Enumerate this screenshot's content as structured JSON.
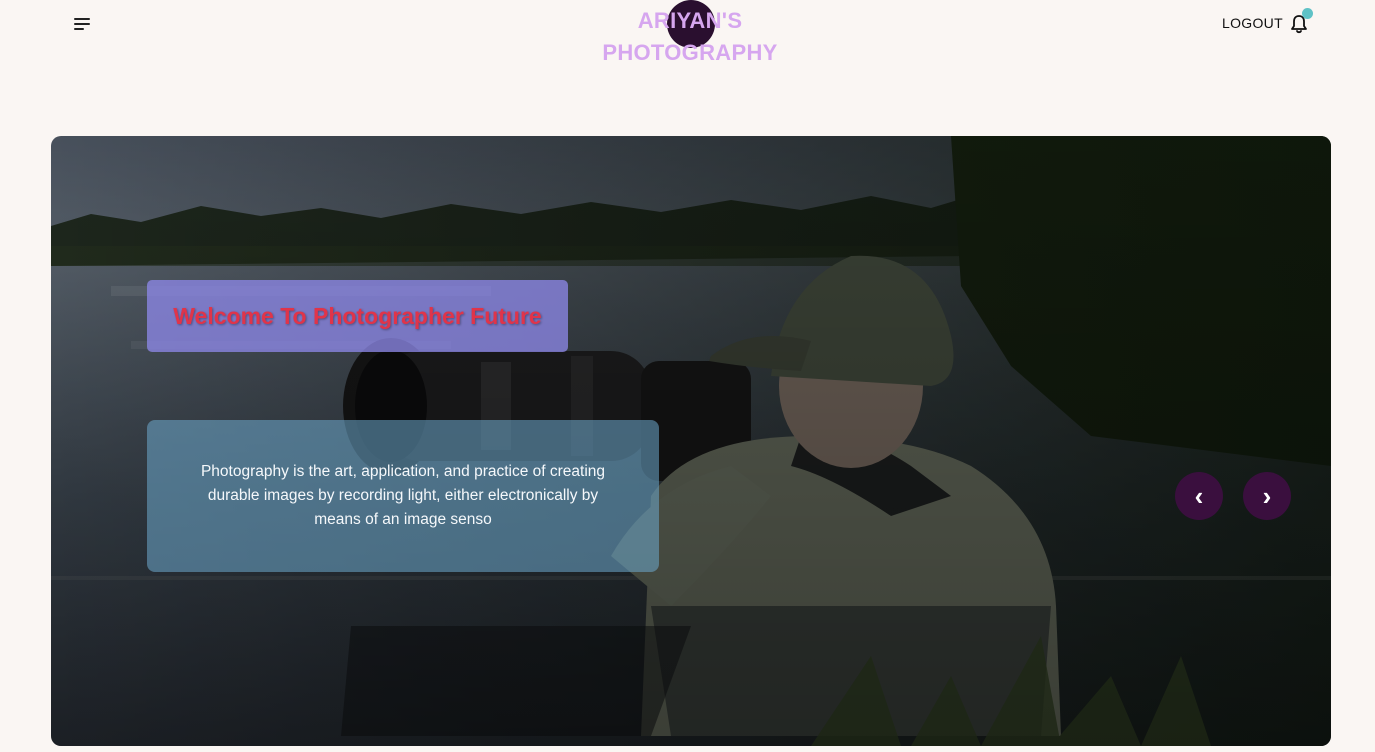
{
  "header": {
    "brand_line1": "ARIYAN'S",
    "brand_line2": "PHOTOGRAPHY",
    "logout_label": "LOGOUT",
    "icons": [
      "menu-icon",
      "bell-icon"
    ]
  },
  "hero": {
    "title": "Welcome To Photographer Future",
    "description": "Photography is the art, application, and practice of creating durable images by recording light, either electronically by means of an image senso",
    "prev_label": "‹",
    "next_label": "›"
  },
  "colors": {
    "page_bg": "#faf6f3",
    "brand_text": "#d6a6ef",
    "brand_circle": "#2a0f2f",
    "title_text": "#e0344a",
    "title_box": "#8c87e6",
    "nav_button": "#3a0f3e",
    "notification_dot": "#5fc2c6"
  }
}
